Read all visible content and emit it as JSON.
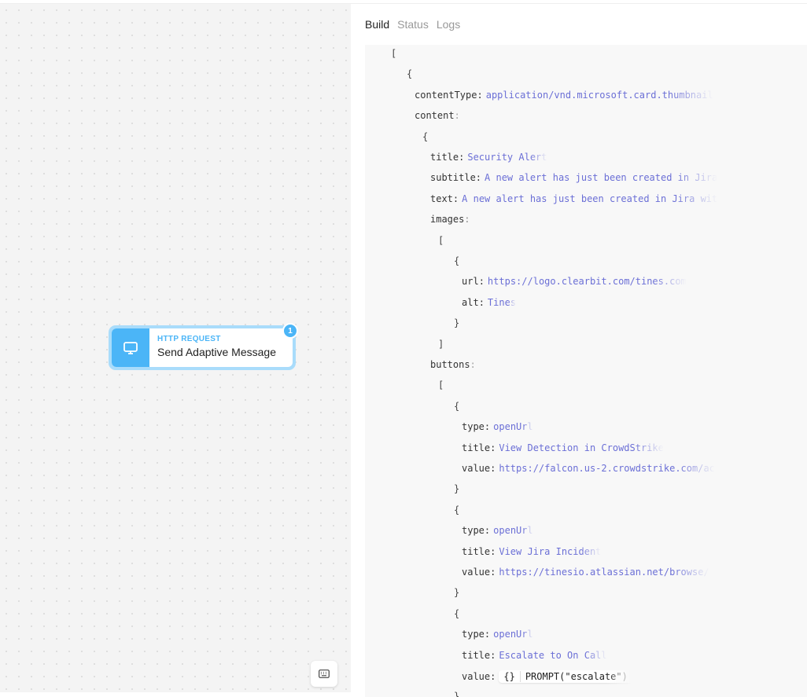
{
  "node": {
    "type": "HTTP REQUEST",
    "name": "Send Adaptive Message",
    "badge": "1",
    "icon": "monitor-icon"
  },
  "tabs": [
    "Build",
    "Status",
    "Logs"
  ],
  "active_tab": "Build",
  "colors": {
    "accent": "#4bb5f7",
    "value": "#6b6fd6"
  },
  "code_lines": [
    {
      "d": 0,
      "b": "["
    },
    {
      "d": 1,
      "b": "{"
    },
    {
      "d": 2,
      "k": "contentType",
      "v": "application/vnd.microsoft.card.thumbnail"
    },
    {
      "d": 2,
      "k": "content"
    },
    {
      "d": 3,
      "b": "{"
    },
    {
      "d": 4,
      "k": "title",
      "v": "Security Alert"
    },
    {
      "d": 4,
      "k": "subtitle",
      "v": "A new alert has just been created in Jira"
    },
    {
      "d": 4,
      "k": "text",
      "v": "A new alert has just been created in Jira wit"
    },
    {
      "d": 4,
      "k": "images"
    },
    {
      "d": 5,
      "b": "["
    },
    {
      "d": 6,
      "b": "{"
    },
    {
      "d": 7,
      "k": "url",
      "v": "https://logo.clearbit.com/tines.com"
    },
    {
      "d": 7,
      "k": "alt",
      "v": "Tines"
    },
    {
      "d": 6,
      "b": "}"
    },
    {
      "d": 5,
      "b": "]"
    },
    {
      "d": 4,
      "k": "buttons"
    },
    {
      "d": 5,
      "b": "["
    },
    {
      "d": 6,
      "b": "{"
    },
    {
      "d": 7,
      "k": "type",
      "v": "openUrl"
    },
    {
      "d": 7,
      "k": "title",
      "v": "View Detection in CrowdStrike"
    },
    {
      "d": 7,
      "k": "value",
      "v": "https://falcon.us-2.crowdstrike.com/ac"
    },
    {
      "d": 6,
      "b": "}"
    },
    {
      "d": 6,
      "b": "{"
    },
    {
      "d": 7,
      "k": "type",
      "v": "openUrl"
    },
    {
      "d": 7,
      "k": "title",
      "v": "View Jira Incident"
    },
    {
      "d": 7,
      "k": "value",
      "v": "https://tinesio.atlassian.net/browse/"
    },
    {
      "d": 6,
      "b": "}"
    },
    {
      "d": 6,
      "b": "{"
    },
    {
      "d": 7,
      "k": "type",
      "v": "openUrl"
    },
    {
      "d": 7,
      "k": "title",
      "v": "Escalate to On Call"
    },
    {
      "d": 7,
      "k": "value",
      "formula": "PROMPT(\"escalate\")",
      "formula_icon": "{}"
    },
    {
      "d": 6,
      "b": "}"
    }
  ]
}
